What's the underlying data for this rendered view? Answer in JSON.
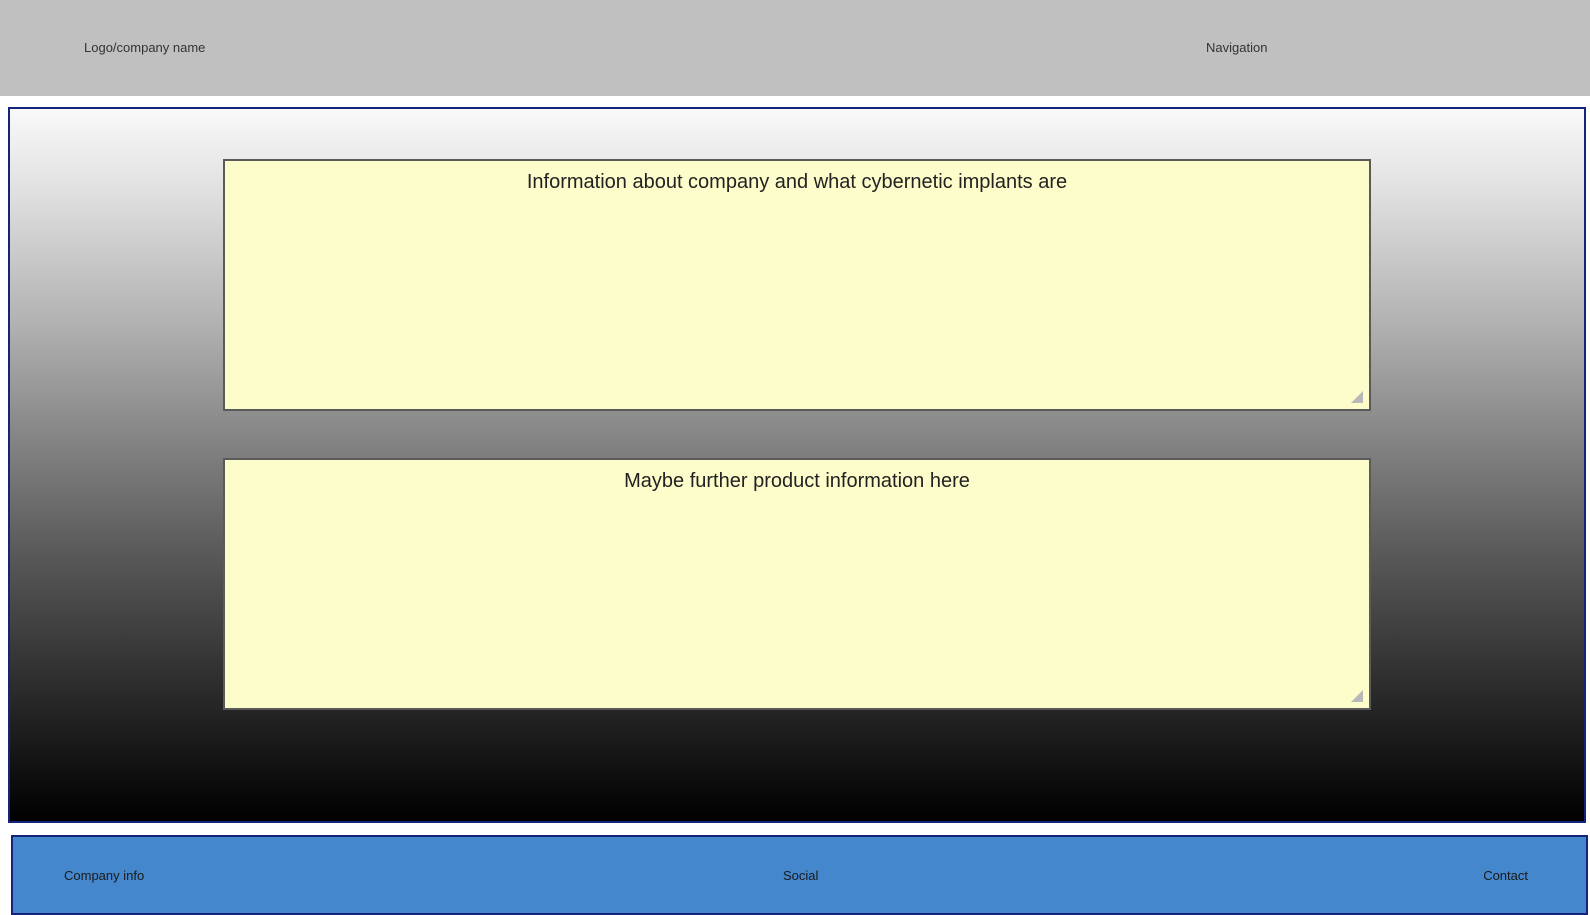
{
  "header": {
    "logo_text": "Logo/company name",
    "navigation_label": "Navigation"
  },
  "main": {
    "boxes": [
      {
        "text": "Information about company and what cybernetic implants are"
      },
      {
        "text": "Maybe further product information here"
      }
    ]
  },
  "footer": {
    "items": [
      {
        "label": "Company info"
      },
      {
        "label": "Social"
      },
      {
        "label": "Contact"
      }
    ]
  },
  "colors": {
    "header_bg": "#c0c0c0",
    "box_bg": "#fdfccb",
    "footer_bg": "#4487cc",
    "border_navy": "#14247a"
  }
}
